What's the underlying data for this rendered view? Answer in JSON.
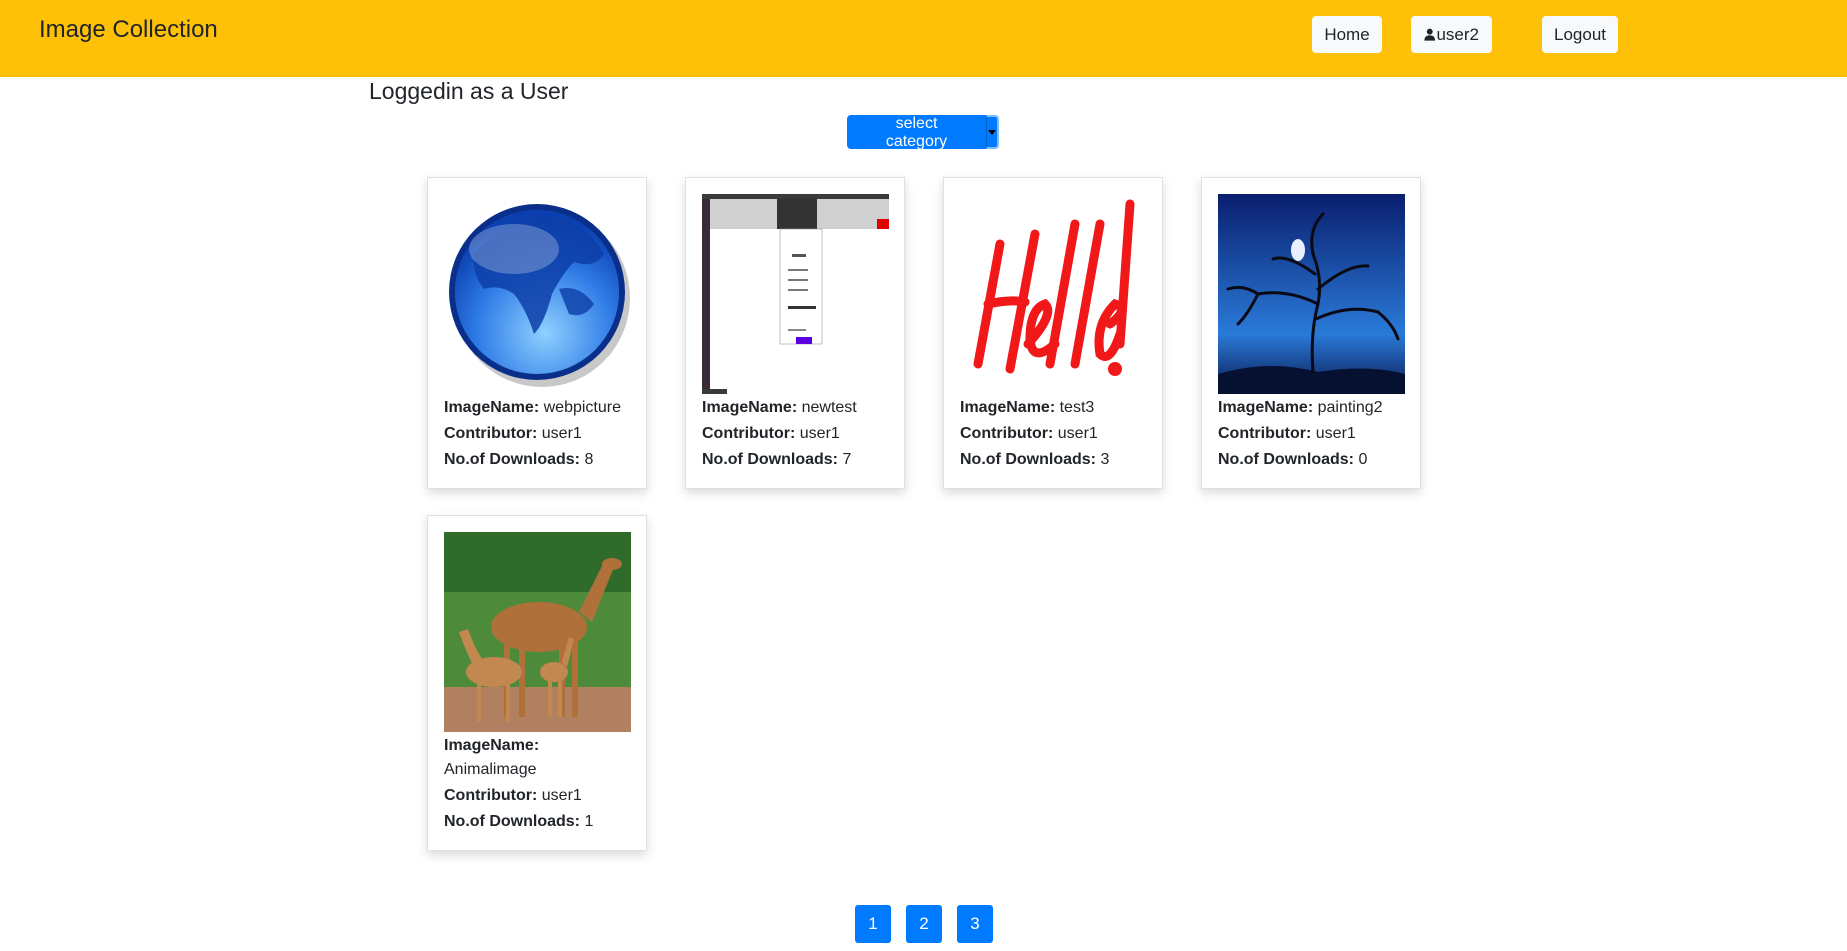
{
  "app": {
    "brand": "Image Collection"
  },
  "nav": {
    "home_label": "Home",
    "user_label": "user2",
    "logout_label": "Logout"
  },
  "status": {
    "logged_text": "Loggedin as a User"
  },
  "filter": {
    "category_label": "select category"
  },
  "labels": {
    "image_name": "ImageName:",
    "contributor": "Contributor:",
    "downloads": "No.of Downloads:"
  },
  "images": [
    {
      "name": "webpicture",
      "contributor": "user1",
      "downloads": "8",
      "thumb": "globe"
    },
    {
      "name": "newtest",
      "contributor": "user1",
      "downloads": "7",
      "thumb": "screenshot"
    },
    {
      "name": "test3",
      "contributor": "user1",
      "downloads": "3",
      "thumb": "hello-lettering"
    },
    {
      "name": "painting2",
      "contributor": "user1",
      "downloads": "0",
      "thumb": "night-tree-painting"
    },
    {
      "name": "Animalimage",
      "contributor": "user1",
      "downloads": "1",
      "thumb": "camels"
    }
  ],
  "pagination": {
    "pages": [
      "1",
      "2",
      "3"
    ]
  },
  "colors": {
    "header": "#ffc107",
    "primary": "#007bff"
  }
}
